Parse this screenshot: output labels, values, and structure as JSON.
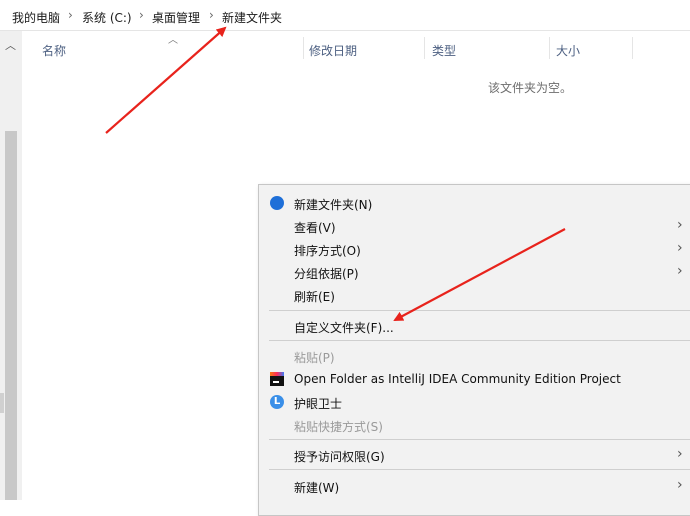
{
  "breadcrumb": {
    "items": [
      "我的电脑",
      "系统 (C:)",
      "桌面管理",
      "新建文件夹"
    ],
    "separator": "›"
  },
  "columns": {
    "name": "名称",
    "modified": "修改日期",
    "type": "类型",
    "size": "大小"
  },
  "empty_message": "该文件夹为空。",
  "context_menu": {
    "items": [
      {
        "label": "新建文件夹(N)",
        "icon": "new-folder-badge-icon",
        "enabled": true,
        "submenu": false
      },
      {
        "label": "查看(V)",
        "enabled": true,
        "submenu": true
      },
      {
        "label": "排序方式(O)",
        "enabled": true,
        "submenu": true
      },
      {
        "label": "分组依据(P)",
        "enabled": true,
        "submenu": true
      },
      {
        "label": "刷新(E)",
        "enabled": true,
        "submenu": false
      },
      {
        "label": "自定义文件夹(F)...",
        "enabled": true,
        "submenu": false
      },
      {
        "label": "粘贴(P)",
        "enabled": false,
        "submenu": false
      },
      {
        "label": "Open Folder as IntelliJ IDEA Community Edition Project",
        "icon": "intellij-icon",
        "enabled": true,
        "submenu": false
      },
      {
        "label": "护眼卫士",
        "icon": "eye-guard-icon",
        "enabled": true,
        "submenu": false
      },
      {
        "label": "粘贴快捷方式(S)",
        "enabled": false,
        "submenu": false
      },
      {
        "label": "授予访问权限(G)",
        "enabled": true,
        "submenu": true
      },
      {
        "label": "新建(W)",
        "enabled": true,
        "submenu": true
      }
    ],
    "submenu_glyph": "›"
  },
  "colors": {
    "annotation_arrow": "#e8231c",
    "menu_bg": "#f2f2f2",
    "header_text": "#4d6082"
  }
}
